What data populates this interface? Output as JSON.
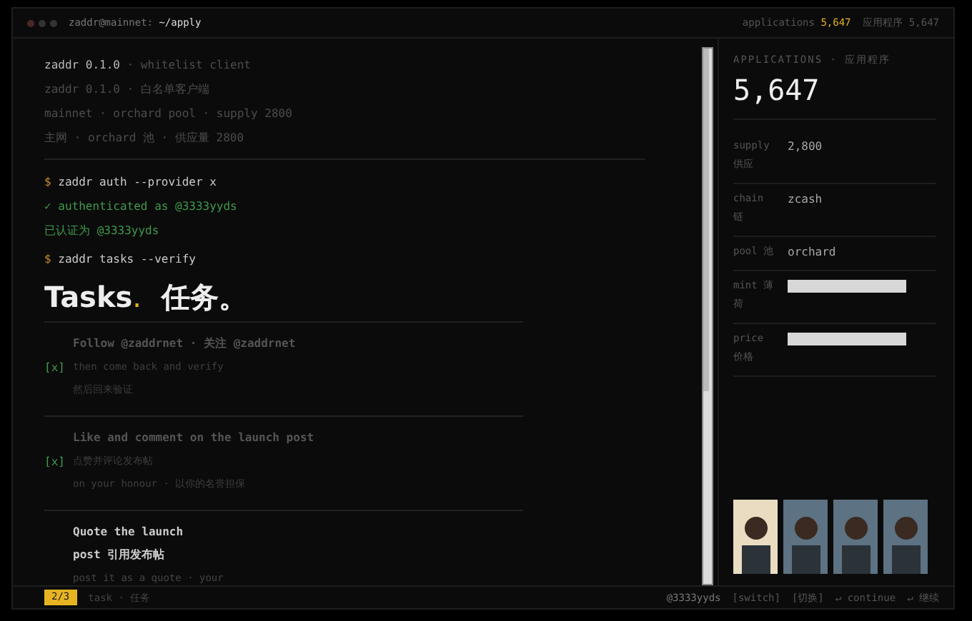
{
  "window": {
    "user": "zaddr@mainnet:",
    "path": "~/apply",
    "stat_label": "applications",
    "stat_value": "5,647",
    "stat_cn": "应用程序 5,647"
  },
  "header": {
    "product": "zaddr 0.1.0",
    "tagline": "· whitelist client",
    "lines": [
      "zaddr 0.1.0 · 白名单客户端",
      "mainnet · orchard pool · supply 2800",
      "主网 · orchard 池 · 供应量 2800"
    ]
  },
  "console": [
    {
      "kind": "command",
      "prompt": "$",
      "text": "zaddr auth --provider x"
    },
    {
      "kind": "success",
      "text": "✓ authenticated as @3333yyds"
    },
    {
      "kind": "success",
      "text": "已认证为 @3333yyds"
    },
    {
      "kind": "command",
      "prompt": "$",
      "text": "zaddr tasks --verify"
    }
  ],
  "heading": {
    "text": "Tasks",
    "dot": ".",
    "cn": "任务。"
  },
  "tasks": [
    {
      "checked": true,
      "current": false,
      "mark": "[x]",
      "title": "Follow @zaddrnet · 关注 @zaddrnet",
      "lines": [
        "then come back and verify",
        "然后回来验证"
      ]
    },
    {
      "checked": true,
      "current": false,
      "mark": "[x]",
      "title": "Like and comment on the launch post",
      "lines": [
        "点赞并评论发布帖",
        "on your honour · 以你的名誉担保"
      ]
    },
    {
      "checked": false,
      "current": true,
      "title": "Quote the launch post  引用发布帖",
      "lines": [
        "post it as a quote · your"
      ]
    }
  ],
  "panel": {
    "label": "APPLICATIONS · 应用程序",
    "value": "5,647",
    "rows": [
      {
        "kind": "text",
        "label": "supply",
        "label_cn": "供应",
        "value": "2,800"
      },
      {
        "kind": "text",
        "label": "chain",
        "label_cn": "链",
        "value": "zcash"
      },
      {
        "kind": "text",
        "label": "pool",
        "label_cn": "池",
        "value": "orchard"
      },
      {
        "kind": "redacted",
        "label": "mint",
        "label_cn": "薄荷"
      },
      {
        "kind": "redacted",
        "label": "price",
        "label_cn": "价格"
      }
    ],
    "avatars": [
      {
        "color": "#e9dcc0"
      },
      {
        "color": "#5d7282"
      },
      {
        "color": "#5d7282"
      },
      {
        "color": "#5d7282"
      }
    ]
  },
  "footer": {
    "badge": "2/3",
    "label": "task · 任务",
    "user": "@3333yyds",
    "actions": [
      "[switch]",
      "[切换]",
      "↵ continue",
      "↵ 继续"
    ]
  }
}
